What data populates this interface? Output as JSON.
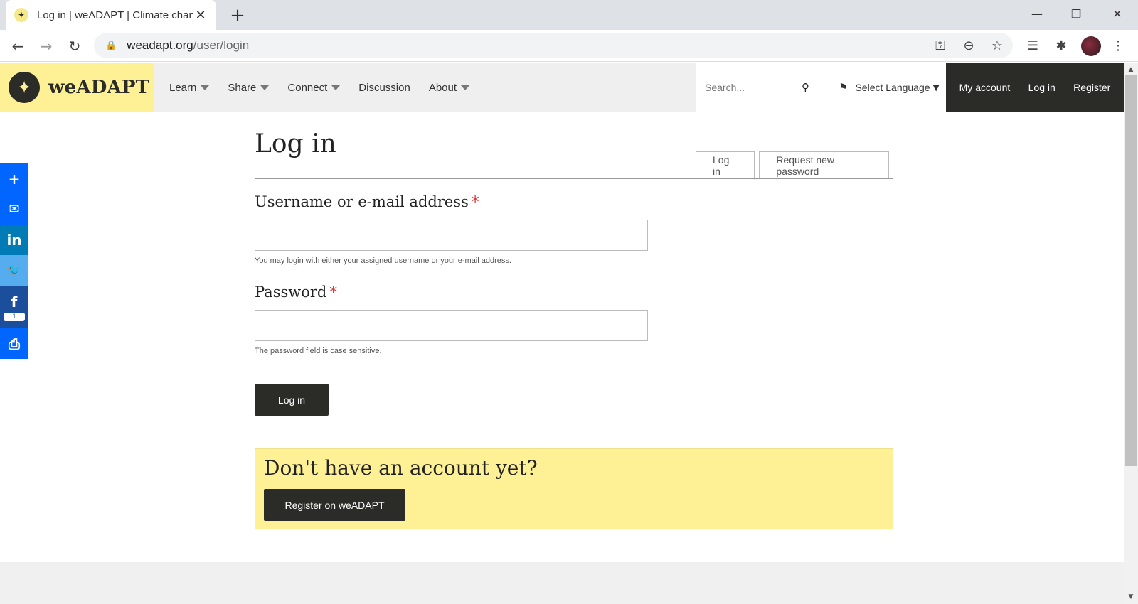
{
  "browser": {
    "tab_title": "Log in | weADAPT | Climate change",
    "tab_close": "✕",
    "new_tab": "+",
    "url_host": "weadapt.org",
    "url_path": "/user/login",
    "window_controls": {
      "minimize": "—",
      "restore": "❐",
      "close": "✕"
    },
    "nav": {
      "back": "←",
      "forward": "→",
      "reload": "↻"
    },
    "toolbar_icons": {
      "key": "⚿",
      "zoom": "⊖",
      "star": "☆",
      "layers": "☰",
      "extensions": "✱",
      "menu": "⋮"
    }
  },
  "site": {
    "brand": "weADAPT",
    "logo_glyph": "✦",
    "nav": [
      {
        "label": "Learn",
        "has_menu": true
      },
      {
        "label": "Share",
        "has_menu": true
      },
      {
        "label": "Connect",
        "has_menu": true
      },
      {
        "label": "Discussion",
        "has_menu": false
      },
      {
        "label": "About",
        "has_menu": true
      }
    ],
    "search": {
      "placeholder": "Search...",
      "icon": "⚲"
    },
    "language": {
      "label": "Select Language",
      "caret": "▼",
      "flag": "⚑"
    },
    "account": {
      "my_account": "My account",
      "login": "Log in",
      "register": "Register"
    }
  },
  "share": {
    "buttons": [
      {
        "name": "share-plus",
        "glyph": "+",
        "color": "#0166ff"
      },
      {
        "name": "share-email",
        "glyph": "✉",
        "color": "#0166ff"
      },
      {
        "name": "share-linkedin",
        "glyph": "in",
        "color": "#007bb5"
      },
      {
        "name": "share-twitter",
        "glyph": "🐦",
        "color": "#55acee"
      },
      {
        "name": "share-facebook",
        "glyph": "f",
        "color": "#1b4f9c",
        "count": "1"
      },
      {
        "name": "share-print",
        "glyph": "⎙",
        "color": "#0166ff"
      }
    ]
  },
  "page": {
    "title": "Log in",
    "tabs": [
      {
        "label": "Log in",
        "active": true
      },
      {
        "label": "Request new password",
        "active": false
      }
    ],
    "username": {
      "label": "Username or e-mail address",
      "required_mark": "*",
      "value": "",
      "help": "You may login with either your assigned username or your e-mail address."
    },
    "password": {
      "label": "Password",
      "required_mark": "*",
      "value": "",
      "help": "The password field is case sensitive."
    },
    "submit_label": "Log in",
    "callout": {
      "heading": "Don't have an account yet?",
      "button": "Register on weADAPT"
    }
  },
  "colors": {
    "brand_yellow": "#fdf095",
    "dark": "#2b2b28",
    "required": "#dd3333"
  }
}
